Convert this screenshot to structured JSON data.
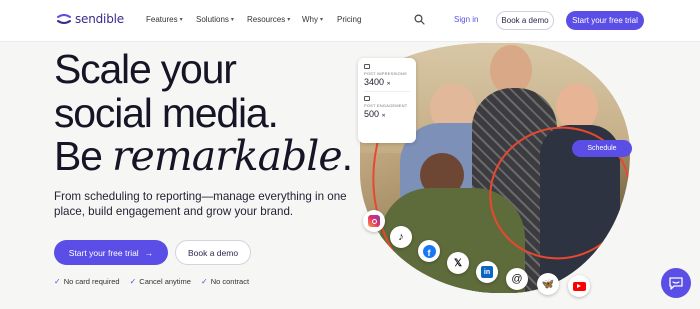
{
  "nav": {
    "logo_text": "sendible",
    "menu": [
      {
        "label": "Features",
        "dropdown": true
      },
      {
        "label": "Solutions",
        "dropdown": true
      },
      {
        "label": "Resources",
        "dropdown": true
      },
      {
        "label": "Why",
        "dropdown": true
      },
      {
        "label": "Pricing",
        "dropdown": false
      }
    ],
    "signin": "Sign in",
    "demo": "Book a demo",
    "trial": "Start your free trial"
  },
  "hero": {
    "line1": "Scale your",
    "line2": "social media.",
    "line3_plain": "Be ",
    "line3_italic": "remarkable",
    "line3_end": ".",
    "subtitle": "From scheduling to reporting—manage everything in one place, build engagement and grow your brand.",
    "cta_primary": "Start your free trial",
    "cta_secondary": "Book a demo",
    "checks": [
      "No card required",
      "Cancel anytime",
      "No contract"
    ]
  },
  "stats": {
    "impressions_label": "POST IMPRESSIONS",
    "impressions_value": "3400",
    "engagement_label": "POST ENGAGEMENT",
    "engagement_value": "500"
  },
  "schedule_label": "Schedule",
  "social_icons": [
    "instagram-icon",
    "tiktok-icon",
    "facebook-icon",
    "x-icon",
    "linkedin-icon",
    "threads-icon",
    "bluesky-icon",
    "youtube-icon"
  ],
  "colors": {
    "brand": "#5b4ee6",
    "accent_ring": "#e8482f",
    "text": "#151526"
  }
}
